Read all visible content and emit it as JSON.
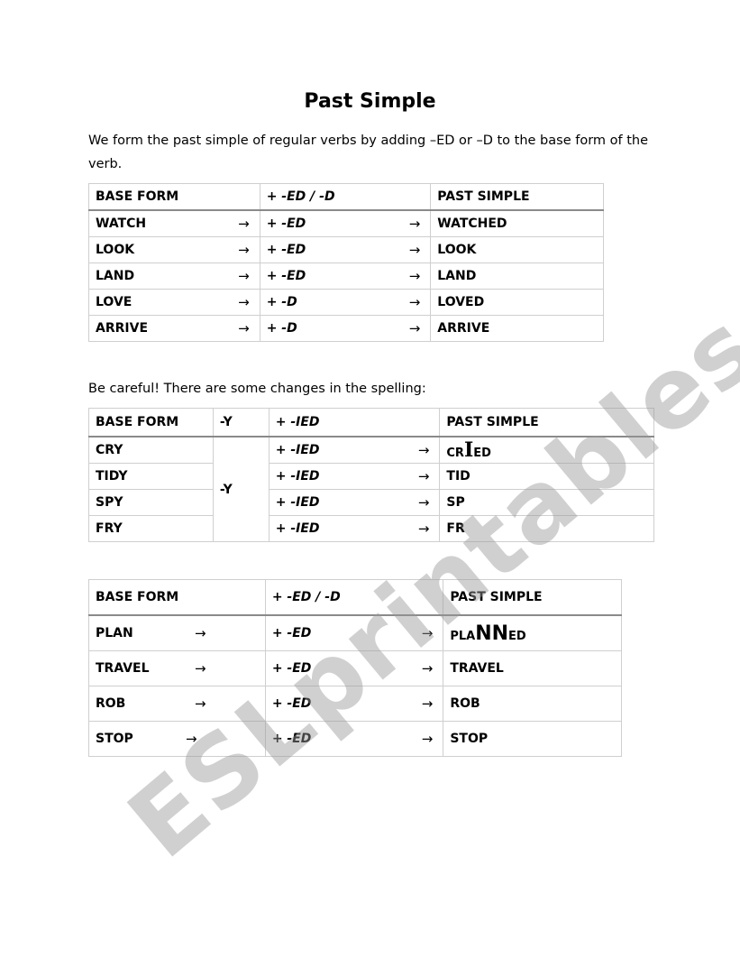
{
  "title": "Past Simple",
  "intro": "We form the past simple of regular verbs by adding –ED or –D to the base form of the verb.",
  "careful": "Be careful! There are some changes in the spelling:",
  "arrow_glyph": "→",
  "table1": {
    "headers": [
      "BASE FORM",
      "+ -ED / -D",
      "PAST SIMPLE"
    ],
    "rows": [
      {
        "base": "WATCH",
        "suffix": "+ -ED",
        "past": "WATCHED"
      },
      {
        "base": "LOOK",
        "suffix": "+ -ED",
        "past": "LOOK"
      },
      {
        "base": "LAND",
        "suffix": "+ -ED",
        "past": "LAND"
      },
      {
        "base": "LOVE",
        "suffix": "+ -D",
        "past": "LOVED"
      },
      {
        "base": "ARRIVE",
        "suffix": "+ -D",
        "past": "ARRIVE"
      }
    ]
  },
  "table2": {
    "headers": [
      "BASE FORM",
      "-Y",
      "+ -IED",
      "PAST SIMPLE"
    ],
    "merged_y": "-Y",
    "rows": [
      {
        "base": "CRY",
        "suffix": "+ -IED",
        "past_pre": "CR",
        "past_big": "I",
        "past_post": "ED"
      },
      {
        "base": "TIDY",
        "suffix": "+ -IED",
        "past": "TID"
      },
      {
        "base": "SPY",
        "suffix": "+ -IED",
        "past": "SP"
      },
      {
        "base": "FRY",
        "suffix": "+ -IED",
        "past": "FR"
      }
    ]
  },
  "table3": {
    "headers": [
      "BASE FORM",
      "+ -ED / -D",
      "PAST SIMPLE"
    ],
    "rows": [
      {
        "base": "PLAN",
        "suffix": "+ -ED",
        "past_pre": "PLA",
        "past_big": "NN",
        "past_post": "ED"
      },
      {
        "base": "TRAVEL",
        "suffix": "+ -ED",
        "past": "TRAVEL"
      },
      {
        "base": "ROB",
        "suffix": "+ -ED",
        "past": "ROB"
      },
      {
        "base": "STOP",
        "suffix": "+ -ED",
        "past": "STOP"
      }
    ]
  },
  "watermark": "ESLprintables.com"
}
